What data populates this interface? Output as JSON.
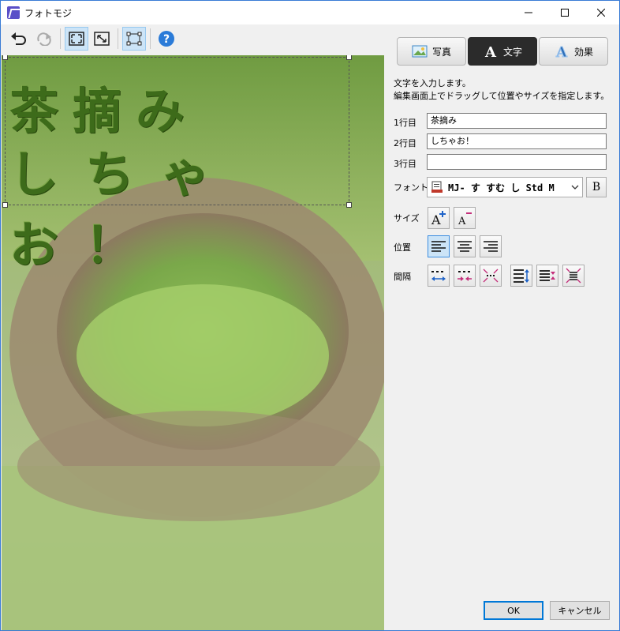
{
  "window": {
    "title": "フォトモジ"
  },
  "tabs": [
    {
      "label": "写真",
      "icon": "photo-icon"
    },
    {
      "label": "文字",
      "icon": "text-a-icon"
    },
    {
      "label": "効果",
      "icon": "effect-a-icon"
    }
  ],
  "instructions": {
    "line1": "文字を入力します。",
    "line2": "編集画面上でドラッグして位置やサイズを指定します。"
  },
  "fields": {
    "line1": {
      "label": "1行目",
      "value": "茶摘み"
    },
    "line2": {
      "label": "2行目",
      "value": "しちゃお！"
    },
    "line3": {
      "label": "3行目",
      "value": ""
    }
  },
  "font": {
    "label": "フォント",
    "value": "MJ- す すむ し  Std M",
    "bold_label": "B"
  },
  "size": {
    "label": "サイズ"
  },
  "position": {
    "label": "位置"
  },
  "spacing": {
    "label": "間隔"
  },
  "canvas_text": {
    "line1": "茶摘み",
    "line2": "しちゃお！"
  },
  "buttons": {
    "ok": "OK",
    "cancel": "キャンセル"
  },
  "colors": {
    "accent": "#0078d7",
    "active_tab": "#2b2b2b",
    "toggle_active": "#cce4f7"
  }
}
